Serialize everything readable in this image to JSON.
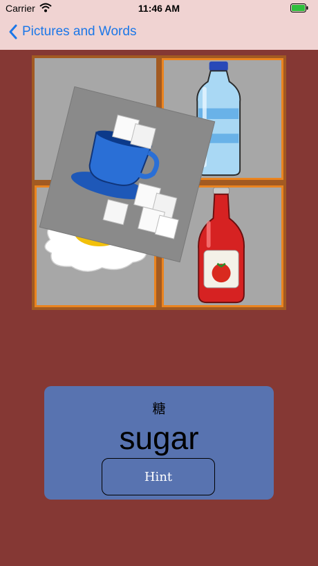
{
  "status_bar": {
    "carrier": "Carrier",
    "time": "11:46 AM"
  },
  "nav": {
    "back_label": "Pictures and Words"
  },
  "tiles": [
    {
      "name": "sugar",
      "icon": "sugar-cubes-icon"
    },
    {
      "name": "water",
      "icon": "water-bottle-icon"
    },
    {
      "name": "egg",
      "icon": "fried-egg-icon"
    },
    {
      "name": "ketchup",
      "icon": "ketchup-bottle-icon"
    }
  ],
  "card": {
    "hanzi": "糖",
    "word": "sugar",
    "hint_label": "Hint"
  },
  "colors": {
    "background": "#853834",
    "bar": "#f0d3d2",
    "accent": "#1b77e8",
    "tile_border": "#ea8420",
    "card": "#5873b0"
  }
}
